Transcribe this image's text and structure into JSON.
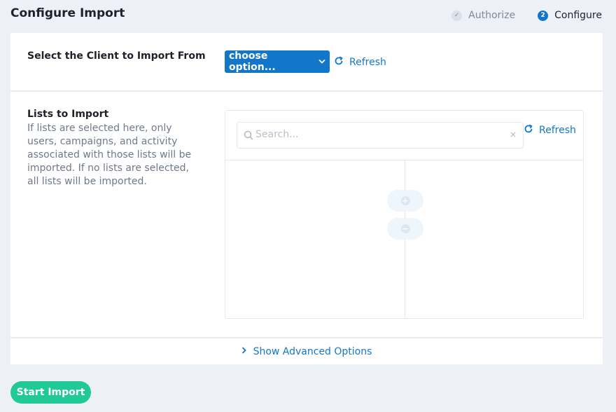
{
  "page": {
    "title": "Configure Import"
  },
  "steps": [
    {
      "label": "Authorize",
      "marker": "✓",
      "state": "done"
    },
    {
      "label": "Configure",
      "marker": "2",
      "state": "active"
    }
  ],
  "client_section": {
    "label": "Select the Client to Import From",
    "select_label": "choose option...",
    "refresh_label": "Refresh"
  },
  "lists_section": {
    "label": "Lists to Import",
    "description": "If lists are selected here, only users, campaigns, and activity associated with those lists will be imported. If no lists are selected, all lists will be imported.",
    "search_placeholder": "Search...",
    "clear_symbol": "×",
    "refresh_label": "Refresh",
    "add_symbol": "+",
    "remove_symbol": "−"
  },
  "advanced": {
    "label": "Show Advanced Options"
  },
  "footer": {
    "start_label": "Start Import"
  },
  "colors": {
    "accent": "#1277c9",
    "success": "#20c997",
    "background": "#edf1f7"
  }
}
